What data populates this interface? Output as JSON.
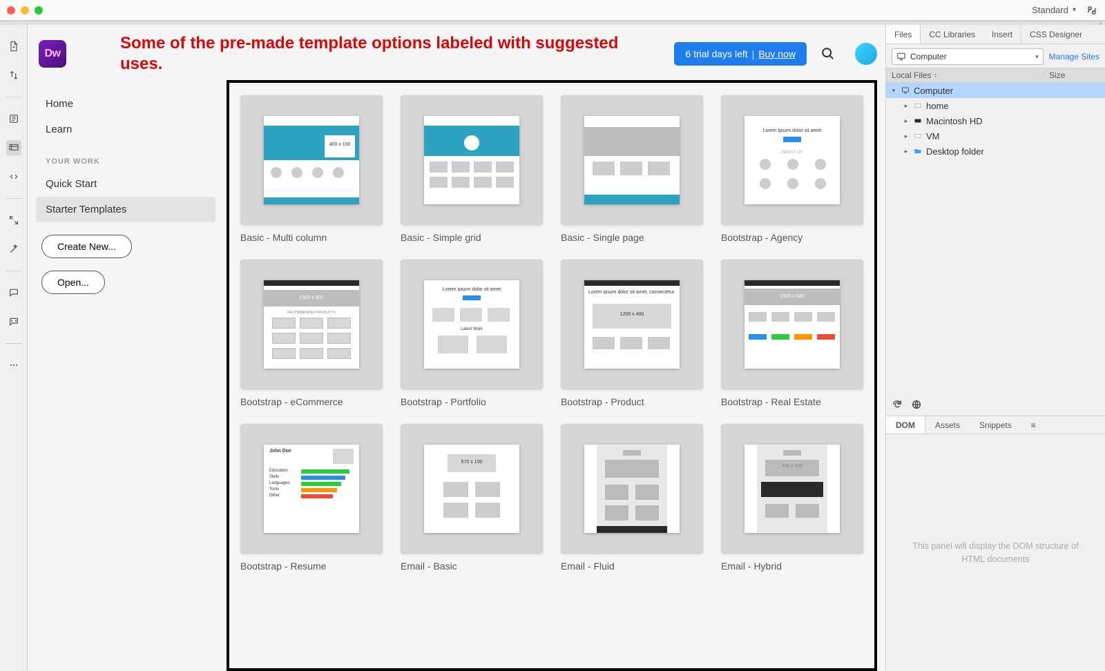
{
  "titlebar": {
    "workspace": "Standard"
  },
  "header": {
    "logo_text": "Dw",
    "annotation": "Some of the pre-made template options labeled with suggested uses.",
    "trial_text": "6 trial days left",
    "trial_sep": "|",
    "buy_now": "Buy now"
  },
  "sidebar": {
    "items": [
      {
        "label": "Home"
      },
      {
        "label": "Learn"
      }
    ],
    "section_label": "YOUR WORK",
    "work_items": [
      {
        "label": "Quick Start"
      },
      {
        "label": "Starter Templates"
      }
    ],
    "btn_create": "Create New...",
    "btn_open": "Open..."
  },
  "templates": [
    {
      "name": "Basic - Multi column"
    },
    {
      "name": "Basic - Simple grid"
    },
    {
      "name": "Basic - Single page"
    },
    {
      "name": "Bootstrap - Agency"
    },
    {
      "name": "Bootstrap - eCommerce"
    },
    {
      "name": "Bootstrap - Portfolio"
    },
    {
      "name": "Bootstrap - Product"
    },
    {
      "name": "Bootstrap - Real Estate"
    },
    {
      "name": "Bootstrap - Resume"
    },
    {
      "name": "Email - Basic"
    },
    {
      "name": "Email - Fluid"
    },
    {
      "name": "Email - Hybrid"
    }
  ],
  "thumb_strings": {
    "dims_1920x500": "1920 x 500",
    "dims_1200x400": "1200 x 400",
    "dims_570x100": "570 x 100",
    "dims_400x100": "400 x 100",
    "lorem_long": "Lorem ipsum dolor sit amet, consectetur.",
    "lorem_short": "Lorem ipsum dolor sit amet",
    "name_johndoe": "John Doe"
  },
  "files_panel": {
    "tabs": [
      "Files",
      "CC Libraries",
      "Insert",
      "CSS Designer"
    ],
    "source_combo": "Computer",
    "manage": "Manage Sites",
    "col_local": "Local Files",
    "col_size": "Size",
    "tree": [
      {
        "label": "Computer",
        "depth": 0,
        "sel": true,
        "open": true,
        "icon": "monitor"
      },
      {
        "label": "home",
        "depth": 1,
        "icon": "drive-white"
      },
      {
        "label": "Macintosh HD",
        "depth": 1,
        "icon": "drive-dark"
      },
      {
        "label": "VM",
        "depth": 1,
        "icon": "drive-white"
      },
      {
        "label": "Desktop folder",
        "depth": 1,
        "icon": "folder-blue"
      }
    ]
  },
  "dom_panel": {
    "tabs": [
      "DOM",
      "Assets",
      "Snippets"
    ],
    "empty_msg": "This panel will display the DOM structure of HTML documents"
  }
}
